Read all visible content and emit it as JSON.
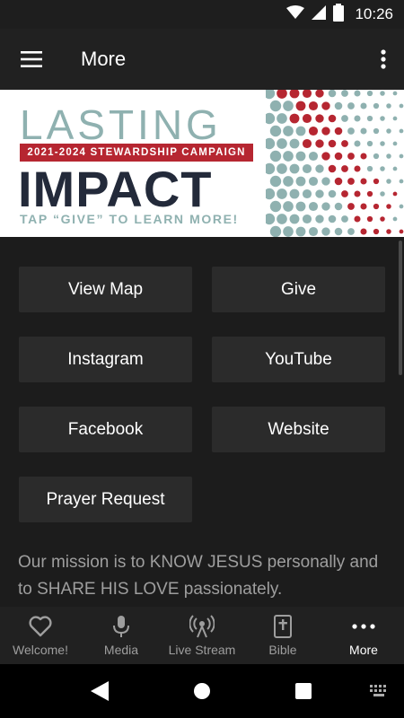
{
  "status_bar": {
    "time": "10:26",
    "icons": [
      "wifi-icon",
      "signal-icon",
      "battery-icon"
    ]
  },
  "app_bar": {
    "title": "More",
    "menu_icon": "hamburger-menu-icon",
    "overflow_icon": "more-vert-icon"
  },
  "banner": {
    "line1": "LASTING",
    "campaign": "2021-2024 STEWARDSHIP CAMPAIGN",
    "line2": "IMPACT",
    "cta": "TAP “GIVE” TO LEARN MORE!",
    "colors": {
      "teal": "#8fb1b0",
      "red": "#b62631",
      "navy": "#232a3a"
    }
  },
  "buttons": [
    "View Map",
    "Give",
    "Instagram",
    "YouTube",
    "Facebook",
    "Website",
    "Prayer Request"
  ],
  "mission": "Our mission is to KNOW JESUS personally and to SHARE HIS LOVE passionately.",
  "bottom_nav": [
    {
      "label": "Welcome!",
      "icon": "heart-icon",
      "active": false
    },
    {
      "label": "Media",
      "icon": "microphone-icon",
      "active": false
    },
    {
      "label": "Live Stream",
      "icon": "broadcast-icon",
      "active": false
    },
    {
      "label": "Bible",
      "icon": "bible-icon",
      "active": false
    },
    {
      "label": "More",
      "icon": "more-horiz-icon",
      "active": true
    }
  ],
  "system_nav": [
    "back-icon",
    "home-icon",
    "recents-icon",
    "keyboard-icon"
  ]
}
